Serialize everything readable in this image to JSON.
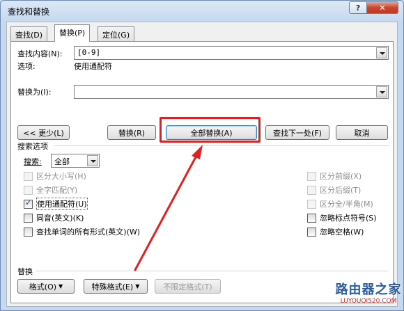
{
  "window": {
    "title": "查找和替换",
    "help_label": "?",
    "close_label": "✕"
  },
  "tabs": [
    {
      "label": "查找(D)",
      "active": false
    },
    {
      "label": "替换(P)",
      "active": true
    },
    {
      "label": "定位(G)",
      "active": false
    }
  ],
  "find": {
    "label": "查找内容(N):",
    "value": "[0-9]",
    "options_label": "选项:",
    "options_value": "使用通配符"
  },
  "replace": {
    "label": "替换为(I):",
    "value": ""
  },
  "buttons": {
    "less": "<< 更少(L)",
    "replace": "替换(R)",
    "replace_all": "全部替换(A)",
    "find_next": "查找下一处(F)",
    "cancel": "取消"
  },
  "search_options": {
    "header": "搜索选项",
    "search_label": "搜索:",
    "search_value": "全部",
    "left_checkboxes": [
      {
        "label": "区分大小写(H)",
        "checked": false,
        "enabled": false
      },
      {
        "label": "全字匹配(Y)",
        "checked": false,
        "enabled": false
      },
      {
        "label": "使用通配符(U)",
        "checked": true,
        "enabled": true
      },
      {
        "label": "同音(英文)(K)",
        "checked": false,
        "enabled": true
      },
      {
        "label": "查找单词的所有形式(英文)(W)",
        "checked": false,
        "enabled": true
      }
    ],
    "right_checkboxes": [
      {
        "label": "区分前缀(X)",
        "checked": false,
        "enabled": false
      },
      {
        "label": "区分后缀(T)",
        "checked": false,
        "enabled": false
      },
      {
        "label": "区分全/半角(M)",
        "checked": false,
        "enabled": false
      },
      {
        "label": "忽略标点符号(S)",
        "checked": false,
        "enabled": true
      },
      {
        "label": "忽略空格(W)",
        "checked": false,
        "enabled": true
      }
    ]
  },
  "replace_section": {
    "header": "替换",
    "format_btn": "格式(O)",
    "special_btn": "特殊格式(E)",
    "no_format_btn": "不限定格式(T)"
  },
  "watermark": {
    "main": "路由器之家",
    "sub": "LUYOUQI520.COM"
  },
  "colors": {
    "highlight": "#e02020",
    "arrow": "#e02020"
  }
}
